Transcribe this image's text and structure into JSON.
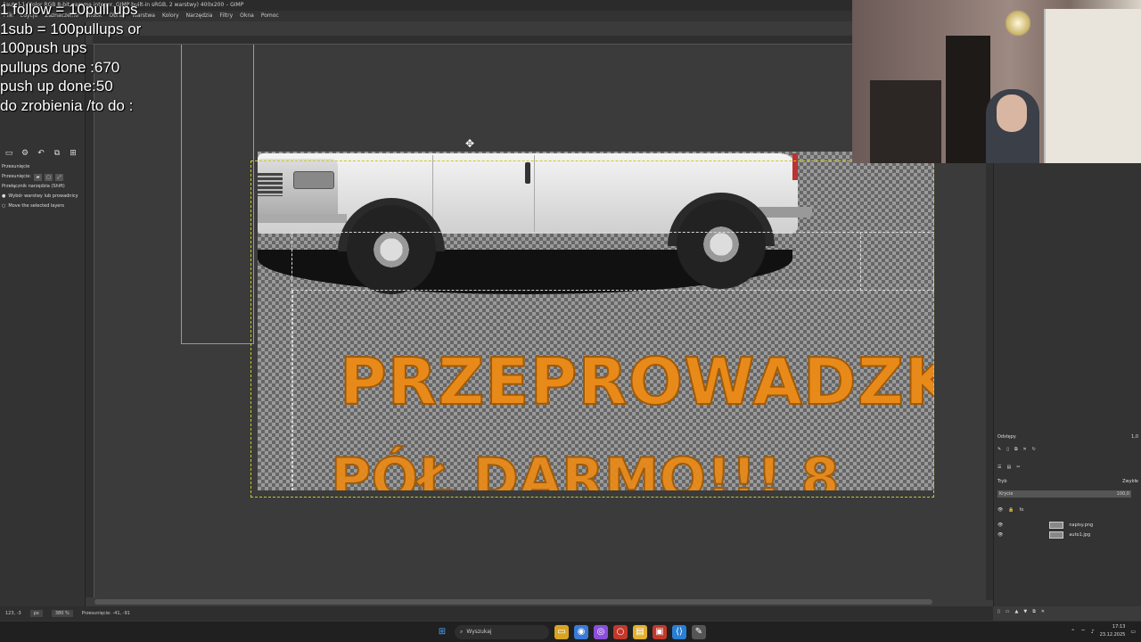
{
  "window": {
    "title": "[auto]-1 (Kolor RGB 8-bit gamma integer, GIMP built-in sRGB, 2 warstwy) 400x200 – GIMP"
  },
  "menu": [
    "Plik",
    "Edycja",
    "Zaznaczenie",
    "Widok",
    "Obraz",
    "Warstwa",
    "Kolory",
    "Narzędzia",
    "Filtry",
    "Okna",
    "Pomoc"
  ],
  "overlay": {
    "lines": [
      "1 follow = 10pull ups",
      "1sub = 100pullups or",
      "100push ups",
      "pullups done :670",
      "push up done:50",
      "do zrobienia /to do :"
    ]
  },
  "tool_options": {
    "title": "Przesunięcie",
    "move_label": "Przesunięcie:",
    "toggle_label": "Przełącznik narzędzia (Shift)",
    "opt1": "Wybór warstwy lub prowadnicy",
    "opt2": "Move the selected layers"
  },
  "canvas": {
    "text_line1": "PRZEPROWADZKI",
    "text_line2": "PÓŁ DARMO!!! 8"
  },
  "right_panel": {
    "spacing_label": "Odstępy",
    "spacing_value": "1,0",
    "mode_label": "Tryb",
    "mode_value": "Zwykłe",
    "opacity_label": "Krycie",
    "opacity_value": "100,0",
    "layers": [
      {
        "name": "napisy.png"
      },
      {
        "name": "auto1.jpg"
      }
    ]
  },
  "status": {
    "coords": "123, -3",
    "unit": "px",
    "zoom": "380 %",
    "message": "Przesunięcie: -41, -91"
  },
  "taskbar": {
    "search_placeholder": "Wyszukaj",
    "time": "17:13",
    "date": "23.12.2025"
  }
}
